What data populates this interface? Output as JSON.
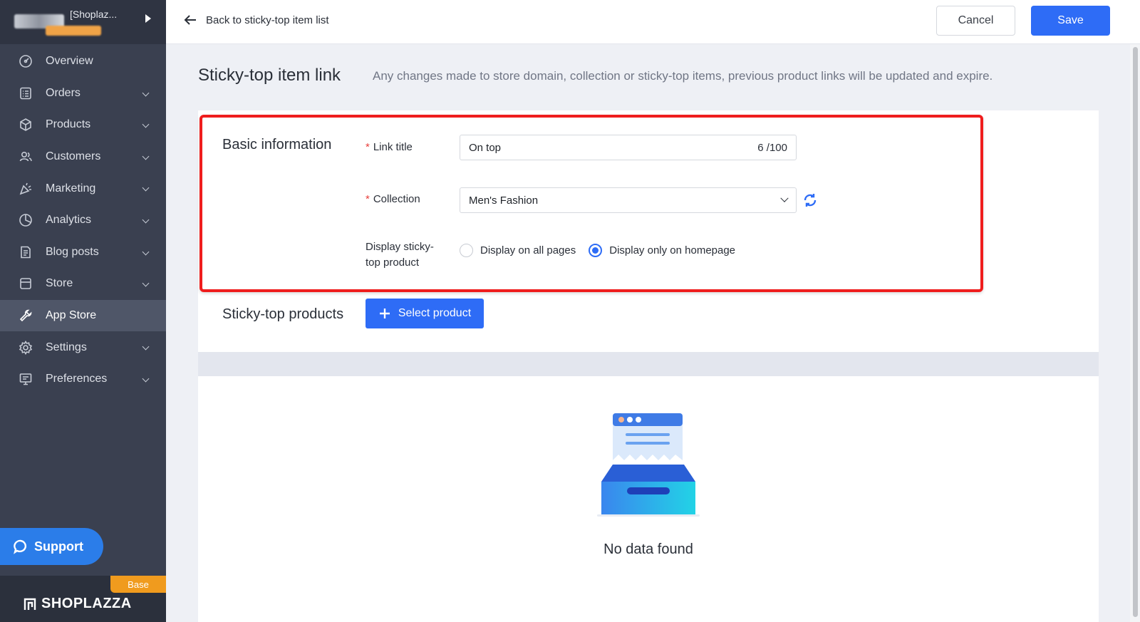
{
  "sidebar": {
    "store_name": "[Shoplaz...",
    "items": [
      {
        "label": "Overview",
        "icon": "gauge-icon",
        "has_submenu": false,
        "active": false
      },
      {
        "label": "Orders",
        "icon": "orders-icon",
        "has_submenu": true,
        "active": false
      },
      {
        "label": "Products",
        "icon": "box-icon",
        "has_submenu": true,
        "active": false
      },
      {
        "label": "Customers",
        "icon": "users-icon",
        "has_submenu": true,
        "active": false
      },
      {
        "label": "Marketing",
        "icon": "megaphone-icon",
        "has_submenu": true,
        "active": false
      },
      {
        "label": "Analytics",
        "icon": "pie-chart-icon",
        "has_submenu": true,
        "active": false
      },
      {
        "label": "Blog posts",
        "icon": "document-icon",
        "has_submenu": true,
        "active": false
      },
      {
        "label": "Store",
        "icon": "storefront-icon",
        "has_submenu": true,
        "active": false
      },
      {
        "label": "App Store",
        "icon": "wrench-icon",
        "has_submenu": false,
        "active": true
      },
      {
        "label": "Settings",
        "icon": "gear-icon",
        "has_submenu": true,
        "active": false
      },
      {
        "label": "Preferences",
        "icon": "monitor-icon",
        "has_submenu": true,
        "active": false
      }
    ],
    "support_label": "Support",
    "plan_badge": "Base",
    "brand": "SHOPLAZZA"
  },
  "topbar": {
    "back_label": "Back to sticky-top item list",
    "cancel_label": "Cancel",
    "save_label": "Save"
  },
  "page": {
    "title": "Sticky-top item link",
    "description": "Any changes made to store domain, collection or sticky-top items, previous product links will be updated and expire."
  },
  "basic_info": {
    "section_title": "Basic information",
    "link_title_label": "Link title",
    "link_title_value": "On top",
    "link_title_counter": "6 /100",
    "collection_label": "Collection",
    "collection_value": "Men's Fashion",
    "display_label_line1": "Display sticky-",
    "display_label_line2": "top product",
    "display_options": [
      {
        "label": "Display on all pages",
        "checked": false
      },
      {
        "label": "Display only on homepage",
        "checked": true
      }
    ]
  },
  "products": {
    "section_title": "Sticky-top products",
    "select_button_label": "Select product",
    "empty_text": "No data found"
  },
  "colors": {
    "primary": "#2e6cf6",
    "sidebar_bg": "#3a4050",
    "highlight": "#ef1d1d",
    "plan_badge": "#f09b1e"
  }
}
